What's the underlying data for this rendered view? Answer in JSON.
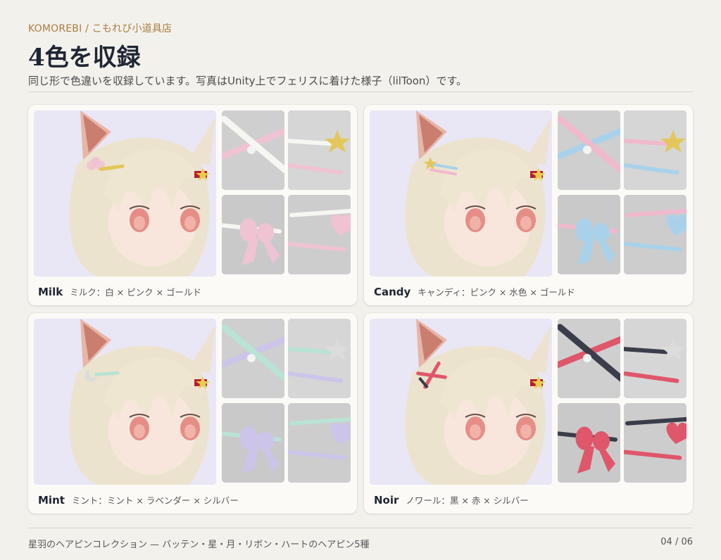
{
  "header": {
    "brand": "KOMOREBI / こもれび小道具店",
    "title": "4色を収録",
    "subtitle": "同じ形で色違いを収録しています。写真はUnity上でフェリスに着けた様子（lilToon）です。"
  },
  "variants": [
    {
      "name": "Milk",
      "desc": "ミルク：白 × ピンク × ゴールド",
      "colors": {
        "a": "#f6f6f3",
        "b": "#efc3d2",
        "c": "#e3c75a"
      }
    },
    {
      "name": "Candy",
      "desc": "キャンディ：ピンク × 水色 × ゴールド",
      "colors": {
        "a": "#f0b9cc",
        "b": "#a9d2ea",
        "c": "#e3c75a"
      }
    },
    {
      "name": "Mint",
      "desc": "ミント：ミント × ラベンダー × シルバー",
      "colors": {
        "a": "#b9e3d4",
        "b": "#cdc4ea",
        "c": "#dcdcdc"
      }
    },
    {
      "name": "Noir",
      "desc": "ノワール：黒 × 赤 × シルバー",
      "colors": {
        "a": "#3a3d4a",
        "b": "#e0566a",
        "c": "#dcdcdc"
      }
    }
  ],
  "footer": {
    "caption": "星羽のヘアピンコレクション — バッテン・星・月・リボン・ハートのヘアピン5種",
    "page": "04 / 06"
  }
}
